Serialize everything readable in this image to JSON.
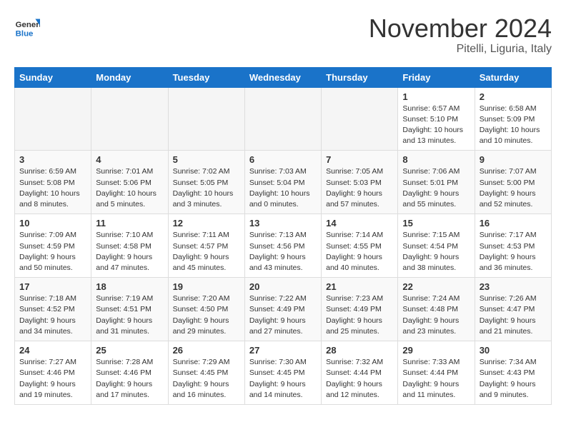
{
  "logo": {
    "line1": "General",
    "line2": "Blue"
  },
  "title": "November 2024",
  "subtitle": "Pitelli, Liguria, Italy",
  "weekdays": [
    "Sunday",
    "Monday",
    "Tuesday",
    "Wednesday",
    "Thursday",
    "Friday",
    "Saturday"
  ],
  "weeks": [
    [
      {
        "day": "",
        "info": ""
      },
      {
        "day": "",
        "info": ""
      },
      {
        "day": "",
        "info": ""
      },
      {
        "day": "",
        "info": ""
      },
      {
        "day": "",
        "info": ""
      },
      {
        "day": "1",
        "info": "Sunrise: 6:57 AM\nSunset: 5:10 PM\nDaylight: 10 hours and 13 minutes."
      },
      {
        "day": "2",
        "info": "Sunrise: 6:58 AM\nSunset: 5:09 PM\nDaylight: 10 hours and 10 minutes."
      }
    ],
    [
      {
        "day": "3",
        "info": "Sunrise: 6:59 AM\nSunset: 5:08 PM\nDaylight: 10 hours and 8 minutes."
      },
      {
        "day": "4",
        "info": "Sunrise: 7:01 AM\nSunset: 5:06 PM\nDaylight: 10 hours and 5 minutes."
      },
      {
        "day": "5",
        "info": "Sunrise: 7:02 AM\nSunset: 5:05 PM\nDaylight: 10 hours and 3 minutes."
      },
      {
        "day": "6",
        "info": "Sunrise: 7:03 AM\nSunset: 5:04 PM\nDaylight: 10 hours and 0 minutes."
      },
      {
        "day": "7",
        "info": "Sunrise: 7:05 AM\nSunset: 5:03 PM\nDaylight: 9 hours and 57 minutes."
      },
      {
        "day": "8",
        "info": "Sunrise: 7:06 AM\nSunset: 5:01 PM\nDaylight: 9 hours and 55 minutes."
      },
      {
        "day": "9",
        "info": "Sunrise: 7:07 AM\nSunset: 5:00 PM\nDaylight: 9 hours and 52 minutes."
      }
    ],
    [
      {
        "day": "10",
        "info": "Sunrise: 7:09 AM\nSunset: 4:59 PM\nDaylight: 9 hours and 50 minutes."
      },
      {
        "day": "11",
        "info": "Sunrise: 7:10 AM\nSunset: 4:58 PM\nDaylight: 9 hours and 47 minutes."
      },
      {
        "day": "12",
        "info": "Sunrise: 7:11 AM\nSunset: 4:57 PM\nDaylight: 9 hours and 45 minutes."
      },
      {
        "day": "13",
        "info": "Sunrise: 7:13 AM\nSunset: 4:56 PM\nDaylight: 9 hours and 43 minutes."
      },
      {
        "day": "14",
        "info": "Sunrise: 7:14 AM\nSunset: 4:55 PM\nDaylight: 9 hours and 40 minutes."
      },
      {
        "day": "15",
        "info": "Sunrise: 7:15 AM\nSunset: 4:54 PM\nDaylight: 9 hours and 38 minutes."
      },
      {
        "day": "16",
        "info": "Sunrise: 7:17 AM\nSunset: 4:53 PM\nDaylight: 9 hours and 36 minutes."
      }
    ],
    [
      {
        "day": "17",
        "info": "Sunrise: 7:18 AM\nSunset: 4:52 PM\nDaylight: 9 hours and 34 minutes."
      },
      {
        "day": "18",
        "info": "Sunrise: 7:19 AM\nSunset: 4:51 PM\nDaylight: 9 hours and 31 minutes."
      },
      {
        "day": "19",
        "info": "Sunrise: 7:20 AM\nSunset: 4:50 PM\nDaylight: 9 hours and 29 minutes."
      },
      {
        "day": "20",
        "info": "Sunrise: 7:22 AM\nSunset: 4:49 PM\nDaylight: 9 hours and 27 minutes."
      },
      {
        "day": "21",
        "info": "Sunrise: 7:23 AM\nSunset: 4:49 PM\nDaylight: 9 hours and 25 minutes."
      },
      {
        "day": "22",
        "info": "Sunrise: 7:24 AM\nSunset: 4:48 PM\nDaylight: 9 hours and 23 minutes."
      },
      {
        "day": "23",
        "info": "Sunrise: 7:26 AM\nSunset: 4:47 PM\nDaylight: 9 hours and 21 minutes."
      }
    ],
    [
      {
        "day": "24",
        "info": "Sunrise: 7:27 AM\nSunset: 4:46 PM\nDaylight: 9 hours and 19 minutes."
      },
      {
        "day": "25",
        "info": "Sunrise: 7:28 AM\nSunset: 4:46 PM\nDaylight: 9 hours and 17 minutes."
      },
      {
        "day": "26",
        "info": "Sunrise: 7:29 AM\nSunset: 4:45 PM\nDaylight: 9 hours and 16 minutes."
      },
      {
        "day": "27",
        "info": "Sunrise: 7:30 AM\nSunset: 4:45 PM\nDaylight: 9 hours and 14 minutes."
      },
      {
        "day": "28",
        "info": "Sunrise: 7:32 AM\nSunset: 4:44 PM\nDaylight: 9 hours and 12 minutes."
      },
      {
        "day": "29",
        "info": "Sunrise: 7:33 AM\nSunset: 4:44 PM\nDaylight: 9 hours and 11 minutes."
      },
      {
        "day": "30",
        "info": "Sunrise: 7:34 AM\nSunset: 4:43 PM\nDaylight: 9 hours and 9 minutes."
      }
    ]
  ]
}
